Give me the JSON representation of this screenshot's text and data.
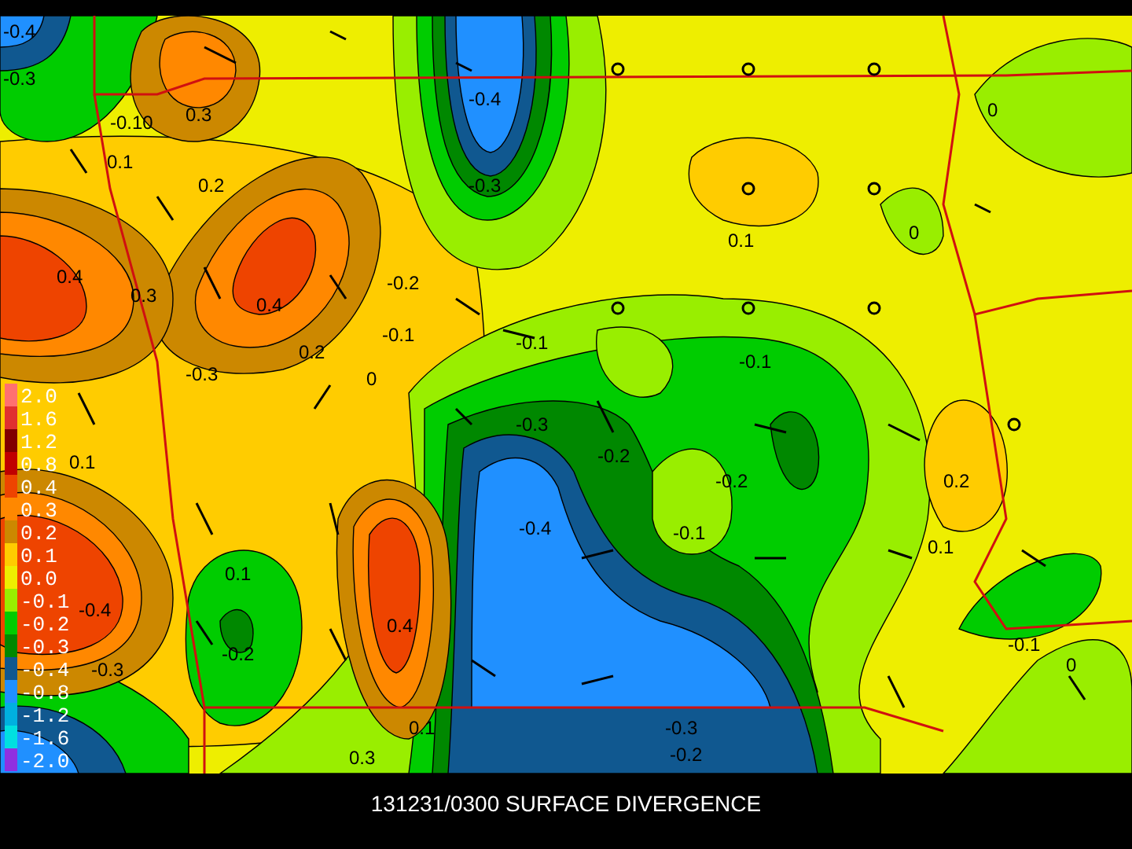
{
  "map": {
    "contour_labels": [
      "-0.4",
      "-0.3",
      "-0.10",
      "0.3",
      "-0.4",
      "0",
      "0.1",
      "0.2",
      "-0.3",
      "0.1",
      "0",
      "0.4",
      "0.3",
      "0.4",
      "-0.2",
      "0.2",
      "-0.3",
      "-0.1",
      "-0.1",
      "-0.1",
      "0",
      "0.1",
      "-0.3",
      "-0.2",
      "-0.2",
      "0.2",
      "-0.4",
      "0.1",
      "-0.1",
      "0.1",
      "-0.1",
      "0.4",
      "-0.2",
      "-0.4",
      "-0.3",
      "0",
      "0.1",
      "-0.3",
      "0.3",
      "-0.2"
    ]
  },
  "legend": [
    {
      "label": "2.0",
      "color": "#ff7070"
    },
    {
      "label": "1.6",
      "color": "#e03030"
    },
    {
      "label": "1.2",
      "color": "#800000"
    },
    {
      "label": "0.8",
      "color": "#c00000"
    },
    {
      "label": "0.4",
      "color": "#ee4400"
    },
    {
      "label": "0.3",
      "color": "#ff8800"
    },
    {
      "label": "0.2",
      "color": "#cc8800"
    },
    {
      "label": "0.1",
      "color": "#ffcc00"
    },
    {
      "label": "0.0",
      "color": "#eeee00"
    },
    {
      "label": "-0.1",
      "color": "#99ee00"
    },
    {
      "label": "-0.2",
      "color": "#00cc00"
    },
    {
      "label": "-0.3",
      "color": "#008800"
    },
    {
      "label": "-0.4",
      "color": "#105890"
    },
    {
      "label": "-0.8",
      "color": "#2090ff"
    },
    {
      "label": "-1.2",
      "color": "#00b0e0"
    },
    {
      "label": "-1.6",
      "color": "#00e0e0"
    },
    {
      "label": "-2.0",
      "color": "#9030e0"
    }
  ],
  "title": "131231/0300 SURFACE DIVERGENCE"
}
